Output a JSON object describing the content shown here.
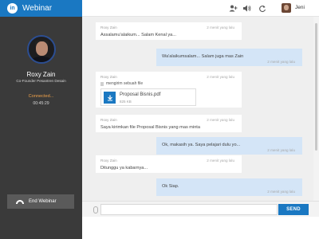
{
  "app": {
    "logo": "in",
    "title": "Webinar"
  },
  "presenter": {
    "name": "Roxy Zain",
    "role": "Co-Founder Pesantren Desain",
    "status": "Connected...",
    "timer": "00:45:29"
  },
  "end_button_label": "End Webinar",
  "topbar": {
    "icons": [
      "add-user-icon",
      "volume-icon",
      "refresh-icon"
    ],
    "user_name": "Jeni"
  },
  "messages": [
    {
      "direction": "in",
      "sender": "Roxy Zain",
      "time": "2 menit yang lalu",
      "text": "Assalamu'alaikum... Salam Kenal ya..."
    },
    {
      "direction": "out",
      "time": "2 menit yang lalu",
      "text": "Wa'alaikumsalam... Salam juga mas Zain"
    },
    {
      "direction": "in",
      "sender": "Roxy Zain",
      "time": "2 menit yang lalu",
      "file_note": "mengirim sebuah file",
      "file_name": "Proposal Bisnis.pdf",
      "file_size": "825 KB"
    },
    {
      "direction": "in",
      "sender": "Roxy Zain",
      "time": "2 menit yang lalu",
      "text": "Saya kirimkan file Proposal Bisnis yang mas minta"
    },
    {
      "direction": "out",
      "time": "2 menit yang lalu",
      "text": "Ok, makasih ya. Saya pelajari dulu yo..."
    },
    {
      "direction": "in",
      "sender": "Roxy Zain",
      "time": "2 menit yang lalu",
      "text": "Ditunggu ya kabarnya..."
    },
    {
      "direction": "out",
      "time": "2 menit yang lalu",
      "text": "Ok Siap."
    }
  ],
  "composer": {
    "placeholder": "",
    "send_label": "SEND"
  },
  "colors": {
    "brand": "#1a78c2",
    "sidebar": "#3a3a3a",
    "status": "#f0a24a",
    "outgoing_bubble": "#d4e5f7"
  }
}
